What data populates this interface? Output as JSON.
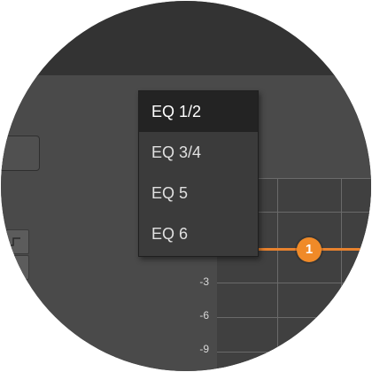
{
  "dropdown": {
    "items": [
      {
        "label": "EQ 1/2",
        "selected": true
      },
      {
        "label": "EQ 3/4",
        "selected": false
      },
      {
        "label": "EQ 5",
        "selected": false
      },
      {
        "label": "EQ 6",
        "selected": false
      }
    ]
  },
  "graph": {
    "y_labels": [
      "-3",
      "-6",
      "-9"
    ],
    "node_label": "1",
    "node_color": "#f08a28",
    "curve_color": "#e8822e"
  },
  "left_panel": {
    "filter_icon": "high-pass-filter-icon"
  }
}
